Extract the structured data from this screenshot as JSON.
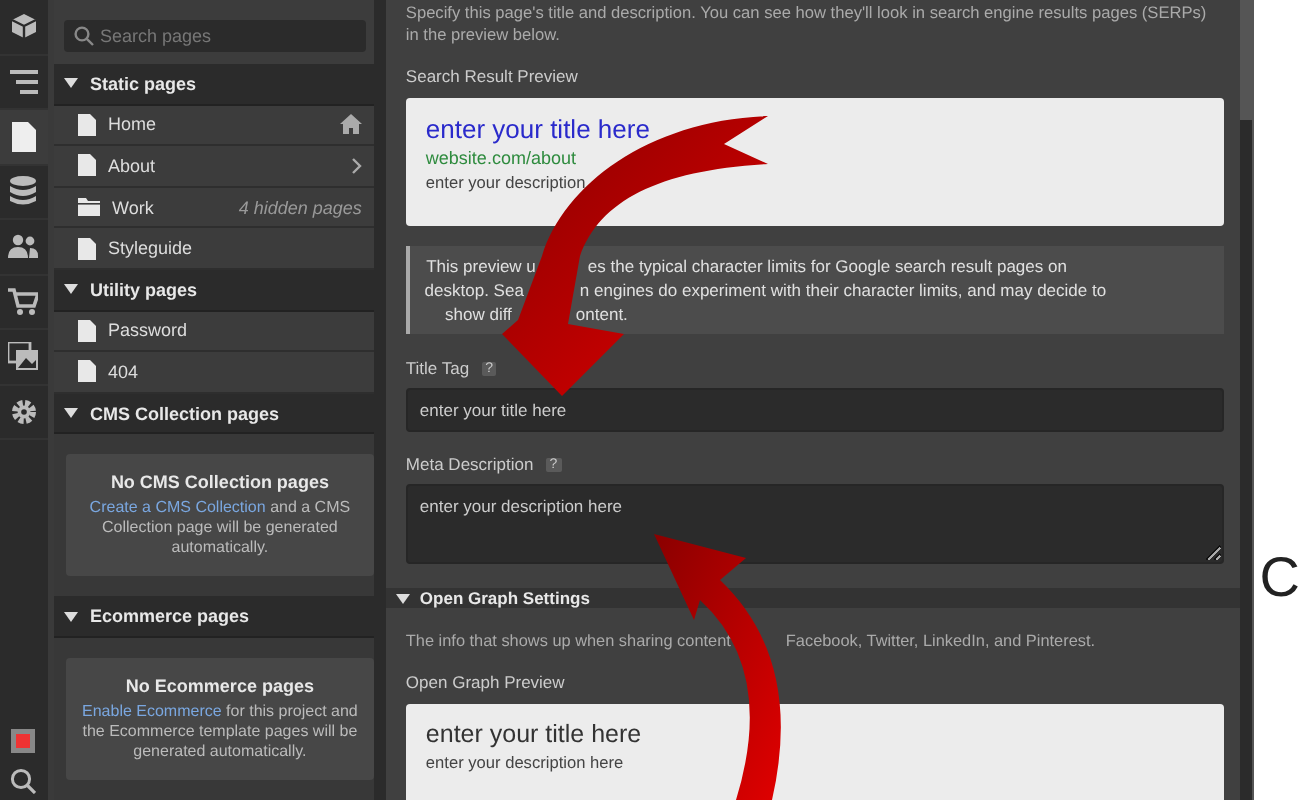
{
  "icon_bar": {
    "items": [
      {
        "selected": false
      },
      {
        "selected": false
      },
      {
        "selected": true
      },
      {
        "selected": false
      },
      {
        "selected": false
      },
      {
        "selected": false
      },
      {
        "selected": false
      },
      {
        "selected": false
      }
    ],
    "bottom_items": [
      {
        "selected": false
      },
      {
        "selected": false
      }
    ]
  },
  "pages_panel": {
    "search": {
      "placeholder": "Search pages"
    },
    "sections": [
      {
        "title": "Static pages",
        "expanded": true,
        "pages": [
          {
            "name": "Home",
            "kind": "page",
            "is_home": true,
            "has_subpages": false
          },
          {
            "name": "About",
            "kind": "page",
            "is_home": false,
            "has_subpages": true
          },
          {
            "name": "Work",
            "kind": "folder",
            "is_home": false,
            "has_subpages": false,
            "note": "4 hidden pages"
          },
          {
            "name": "Styleguide",
            "kind": "page",
            "is_home": false,
            "has_subpages": false
          }
        ]
      },
      {
        "title": "Utility pages",
        "expanded": true,
        "pages": [
          {
            "name": "Password",
            "kind": "page",
            "is_home": false,
            "has_subpages": false
          },
          {
            "name": "404",
            "kind": "page",
            "is_home": false,
            "has_subpages": false
          }
        ]
      },
      {
        "title": "CMS Collection pages",
        "expanded": true,
        "empty": {
          "heading": "No CMS Collection pages",
          "link": "Create a CMS Collection",
          "text": " and a CMS Collection page will be generated automatically."
        }
      },
      {
        "title": "Ecommerce pages",
        "expanded": true,
        "empty": {
          "heading": "No Ecommerce pages",
          "link": "Enable Ecommerce",
          "text": " for this project and the Ecommerce template pages will be generated automatically."
        }
      }
    ]
  },
  "settings": {
    "intro": "Specify this page's title and description. You can see how they'll look in search engine results pages (SERPs) in the preview below.",
    "serp_label": "Search Result Preview",
    "serp_preview": {
      "title": "enter your title here",
      "url": "website.com/about",
      "description": "enter your description"
    },
    "note_lines": [
      [
        "This preview u",
        "es the typical character limits for Google search result pages on"
      ],
      [
        "desktop. Sea",
        "n engines do experiment with their character limits, and may decide to"
      ],
      [
        "show diff",
        "ontent."
      ]
    ],
    "fields": [
      {
        "label": "Title Tag",
        "help": "?",
        "placeholder": "enter your title here",
        "kind": "input"
      },
      {
        "label": "Meta Description",
        "help": "?",
        "placeholder": "enter your description here",
        "kind": "textarea"
      }
    ],
    "og_section": {
      "title": "Open Graph Settings",
      "expanded": true,
      "text_parts": [
        "The info that shows up when sharing content",
        "Facebook, Twitter, LinkedIn, and Pinterest."
      ],
      "preview_label": "Open Graph Preview",
      "preview": {
        "title": "enter your title here",
        "description": "enter your description here"
      }
    }
  },
  "outside_text": "C"
}
